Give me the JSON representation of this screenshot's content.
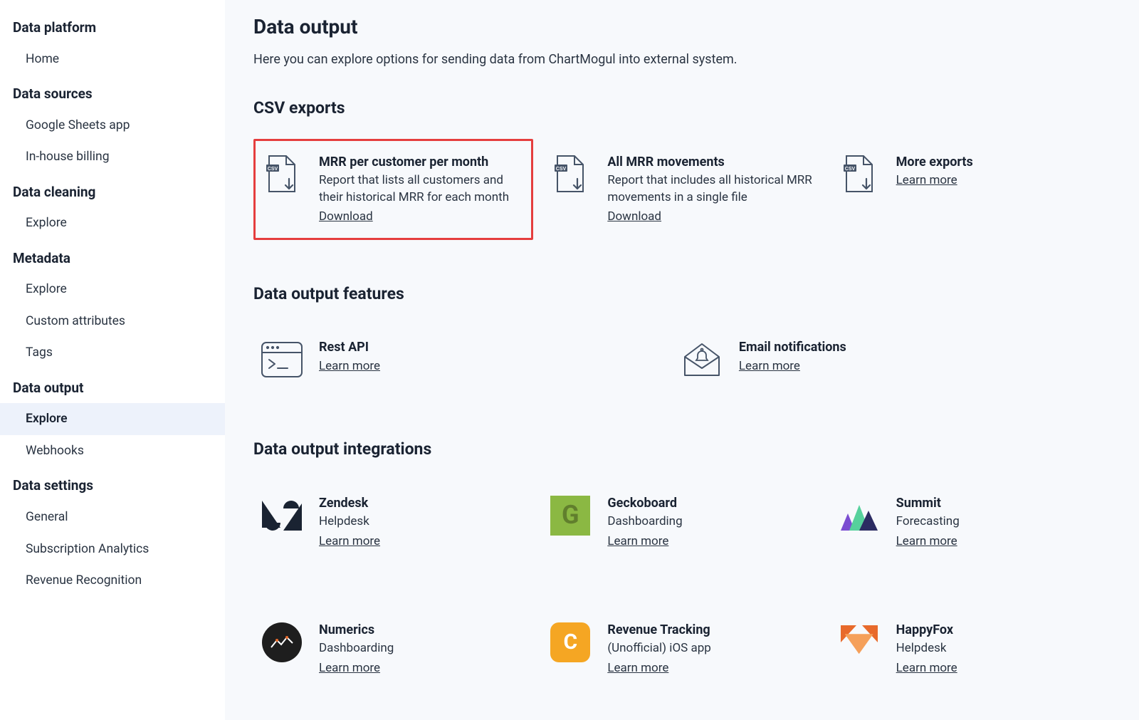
{
  "sidebar": {
    "groups": [
      {
        "title": "Data platform",
        "items": [
          {
            "label": "Home",
            "active": false
          }
        ]
      },
      {
        "title": "Data sources",
        "items": [
          {
            "label": "Google Sheets app",
            "active": false
          },
          {
            "label": "In-house billing",
            "active": false
          }
        ]
      },
      {
        "title": "Data cleaning",
        "items": [
          {
            "label": "Explore",
            "active": false
          }
        ]
      },
      {
        "title": "Metadata",
        "items": [
          {
            "label": "Explore",
            "active": false
          },
          {
            "label": "Custom attributes",
            "active": false
          },
          {
            "label": "Tags",
            "active": false
          }
        ]
      },
      {
        "title": "Data output",
        "items": [
          {
            "label": "Explore",
            "active": true
          },
          {
            "label": "Webhooks",
            "active": false
          }
        ]
      },
      {
        "title": "Data settings",
        "items": [
          {
            "label": "General",
            "active": false
          },
          {
            "label": "Subscription Analytics",
            "active": false
          },
          {
            "label": "Revenue Recognition",
            "active": false
          }
        ]
      }
    ]
  },
  "main": {
    "title": "Data output",
    "description": "Here you can explore options for sending data from ChartMogul into external system.",
    "csv_section_title": "CSV exports",
    "csv_cards": [
      {
        "title": "MRR per customer per month",
        "desc": "Report that lists all customers and their historical MRR for each month",
        "link": "Download",
        "highlighted": true
      },
      {
        "title": "All MRR movements",
        "desc": "Report that includes all historical MRR movements in a single file",
        "link": "Download",
        "highlighted": false
      },
      {
        "title": "More exports",
        "desc": "",
        "link": "Learn more",
        "highlighted": false
      }
    ],
    "features_section_title": "Data output features",
    "feature_cards": [
      {
        "title": "Rest API",
        "desc": "",
        "link": "Learn more",
        "icon": "api"
      },
      {
        "title": "Email notifications",
        "desc": "",
        "link": "Learn more",
        "icon": "email"
      }
    ],
    "integrations_section_title": "Data output integrations",
    "integration_cards": [
      {
        "title": "Zendesk",
        "desc": "Helpdesk",
        "link": "Learn more",
        "icon": "zendesk"
      },
      {
        "title": "Geckoboard",
        "desc": "Dashboarding",
        "link": "Learn more",
        "icon": "gecko"
      },
      {
        "title": "Summit",
        "desc": "Forecasting",
        "link": "Learn more",
        "icon": "summit"
      },
      {
        "title": "Numerics",
        "desc": "Dashboarding",
        "link": "Learn more",
        "icon": "numerics"
      },
      {
        "title": "Revenue Tracking",
        "desc": "(Unofficial) iOS app",
        "link": "Learn more",
        "icon": "revenue"
      },
      {
        "title": "HappyFox",
        "desc": "Helpdesk",
        "link": "Learn more",
        "icon": "happyfox"
      }
    ]
  }
}
